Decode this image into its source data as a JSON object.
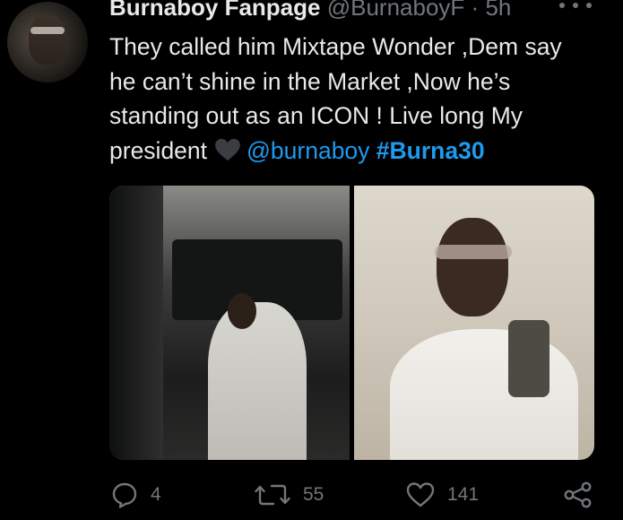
{
  "tweet": {
    "author": {
      "name": "Burnaboy Fanpage",
      "handle": "@BurnaboyF",
      "separator": "·",
      "time": "5h",
      "avatar_icon": "profile-photo"
    },
    "text": {
      "line1": "They called him Mixtape Wonder ,Dem say",
      "line2": "he can’t shine in the Market ,Now he’s",
      "line3": "standing out as an ICON ! Live long My",
      "line4_start": "president",
      "mention": "@burnaboy",
      "hashtag": "#Burna30"
    },
    "media": {
      "photo1_icon": "photo-man-in-car",
      "photo2_icon": "photo-man-selfie"
    },
    "actions": {
      "replies": "4",
      "retweets": "55",
      "likes": "141"
    }
  },
  "colors": {
    "background": "#000000",
    "text": "#e7e9ea",
    "secondary": "#71767b",
    "link": "#1d9bf0"
  }
}
